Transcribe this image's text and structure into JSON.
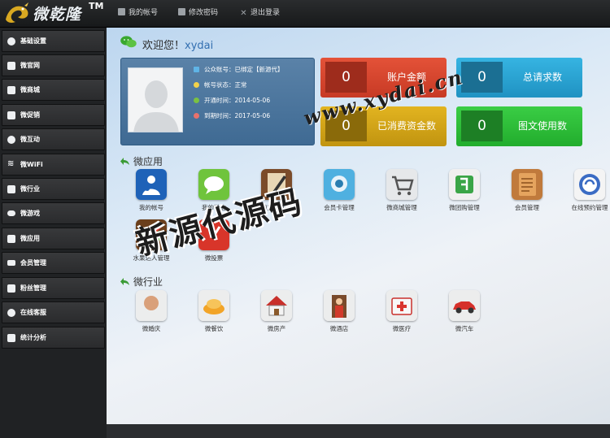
{
  "brand": {
    "name": "微乾隆",
    "tm": "TM"
  },
  "topnav": [
    {
      "label": "我的帐号",
      "icon": "user-icon"
    },
    {
      "label": "修改密码",
      "icon": "edit-icon"
    },
    {
      "label": "退出登录",
      "icon": "close-icon"
    }
  ],
  "sidebar": {
    "items": [
      {
        "label": "基础设置",
        "icon": "gear-icon"
      },
      {
        "label": "微官网",
        "icon": "home-icon"
      },
      {
        "label": "微商城",
        "icon": "cart-icon"
      },
      {
        "label": "微促销",
        "icon": "tag-icon"
      },
      {
        "label": "微互动",
        "icon": "chat-icon"
      },
      {
        "label": "微WiFi",
        "icon": "wifi-icon"
      },
      {
        "label": "微行业",
        "icon": "grid-icon"
      },
      {
        "label": "微游戏",
        "icon": "gamepad-icon"
      },
      {
        "label": "微应用",
        "icon": "apps-icon"
      },
      {
        "label": "会员管理",
        "icon": "member-card-icon"
      },
      {
        "label": "粉丝管理",
        "icon": "list-icon"
      },
      {
        "label": "在线客服",
        "icon": "support-icon"
      },
      {
        "label": "统计分析",
        "icon": "chart-icon"
      }
    ]
  },
  "welcome": {
    "prefix": "欢迎您！",
    "username": "xydai"
  },
  "account_info": [
    {
      "label": "公众账号：已绑定【新源代】",
      "icon": "flag-icon",
      "color": "#5fb4e6"
    },
    {
      "label": "帐号状态：正常",
      "icon": "bulb-icon",
      "color": "#f2d24a"
    },
    {
      "label": "开通时间：2014-05-06",
      "icon": "check-icon",
      "color": "#7ac142"
    },
    {
      "label": "到期时间：2017-05-06",
      "icon": "clock-icon",
      "color": "#e8716c"
    }
  ],
  "stats": [
    {
      "value": "0",
      "label": "账户金额",
      "bg": "#d9442f",
      "inner": "#9e2c1c"
    },
    {
      "value": "0",
      "label": "总请求数",
      "bg": "#2ba3d4",
      "inner": "#1b6f93"
    },
    {
      "value": "0",
      "label": "已消费资金数",
      "bg": "#d2a414",
      "inner": "#8a6a0a"
    },
    {
      "value": "0",
      "label": "图文使用数",
      "bg": "#2ebf3a",
      "inner": "#1d7f25"
    }
  ],
  "sections": {
    "apps_title": "微应用",
    "industry_title": "微行业"
  },
  "apps": [
    {
      "label": "我的帐号",
      "icon": "my-account-icon"
    },
    {
      "label": "我的微信",
      "icon": "wechat-bubble-icon"
    },
    {
      "label": "自定义回复",
      "icon": "notebook-pen-icon"
    },
    {
      "label": "会员卡管理",
      "icon": "camera-robot-icon"
    },
    {
      "label": "微商城管理",
      "icon": "shopping-cart-icon"
    },
    {
      "label": "微团购管理",
      "icon": "group-buy-icon"
    },
    {
      "label": "会员管理",
      "icon": "address-book-icon"
    },
    {
      "label": "在线预约管理",
      "icon": "reservation-icon"
    },
    {
      "label": "水果达人管理",
      "icon": "fruit-ninja-icon"
    },
    {
      "label": "微投票",
      "icon": "vote-icon"
    }
  ],
  "industries": [
    {
      "label": "微婚庆",
      "icon": "wedding-icon"
    },
    {
      "label": "微餐饮",
      "icon": "food-icon"
    },
    {
      "label": "微房产",
      "icon": "house-icon"
    },
    {
      "label": "微酒店",
      "icon": "hotel-icon"
    },
    {
      "label": "微医疗",
      "icon": "medical-kit-icon"
    },
    {
      "label": "微汽车",
      "icon": "car-icon"
    }
  ],
  "watermark": {
    "url": "www.xydai.cn",
    "text": "新源代源码"
  }
}
